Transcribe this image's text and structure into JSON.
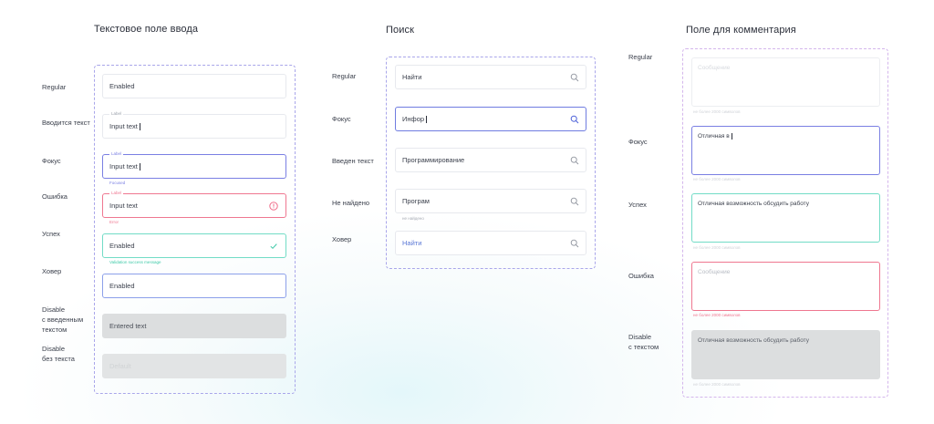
{
  "sections": {
    "text_input": {
      "title": "Текстовое поле ввода",
      "rows": [
        {
          "label": "Regular",
          "value": "Enabled"
        },
        {
          "label": "Вводится текст",
          "floating_label": "Label",
          "value": "Input text"
        },
        {
          "label": "Фокус",
          "floating_label": "Label",
          "value": "Input text",
          "helper": "Focused"
        },
        {
          "label": "Ошибка",
          "floating_label": "Label",
          "value": "Input text",
          "helper": "Error"
        },
        {
          "label": "Успех",
          "value": "Enabled",
          "helper": "Validation success message"
        },
        {
          "label": "Ховер",
          "value": "Enabled"
        },
        {
          "label_lines": [
            "Disable",
            "с введенным",
            "текстом"
          ],
          "value": "Entered text"
        },
        {
          "label_lines": [
            "Disable",
            "без текста"
          ],
          "value": "Default"
        }
      ]
    },
    "search": {
      "title": "Поиск",
      "rows": [
        {
          "label": "Regular",
          "value": "Найти"
        },
        {
          "label": "Фокус",
          "value": "Инфор"
        },
        {
          "label": "Введен текст",
          "value": "Программирование"
        },
        {
          "label": "Не найдено",
          "value": "Програм",
          "helper": "не найдено"
        },
        {
          "label": "Ховер",
          "value": "Найти"
        }
      ]
    },
    "comment": {
      "title": "Поле для комментария",
      "rows": [
        {
          "label": "Regular",
          "placeholder": "Сообщение",
          "helper": "не более 2000 символов"
        },
        {
          "label": "Фокус",
          "value": "Отличная в",
          "helper": "не более 2000 символов"
        },
        {
          "label": "Успех",
          "value": "Отличная возможность обсудить работу",
          "helper": "не более 2000 символов"
        },
        {
          "label": "Ошибка",
          "placeholder": "Сообщение",
          "helper": "не более 2000 символов"
        },
        {
          "label_lines": [
            "Disable",
            "с текстом"
          ],
          "value": "Отличная возможность обсудить работу",
          "helper": "не более 2000 символов"
        }
      ]
    }
  },
  "colors": {
    "focus": "#7a7fe3",
    "error": "#ef7790",
    "success": "#72dcc6",
    "hover": "#5b78d6",
    "frame_blue": "#a9a6ea",
    "frame_purple": "#d4b6ec"
  },
  "icons": [
    "search-icon",
    "error-circle-icon",
    "check-icon"
  ]
}
